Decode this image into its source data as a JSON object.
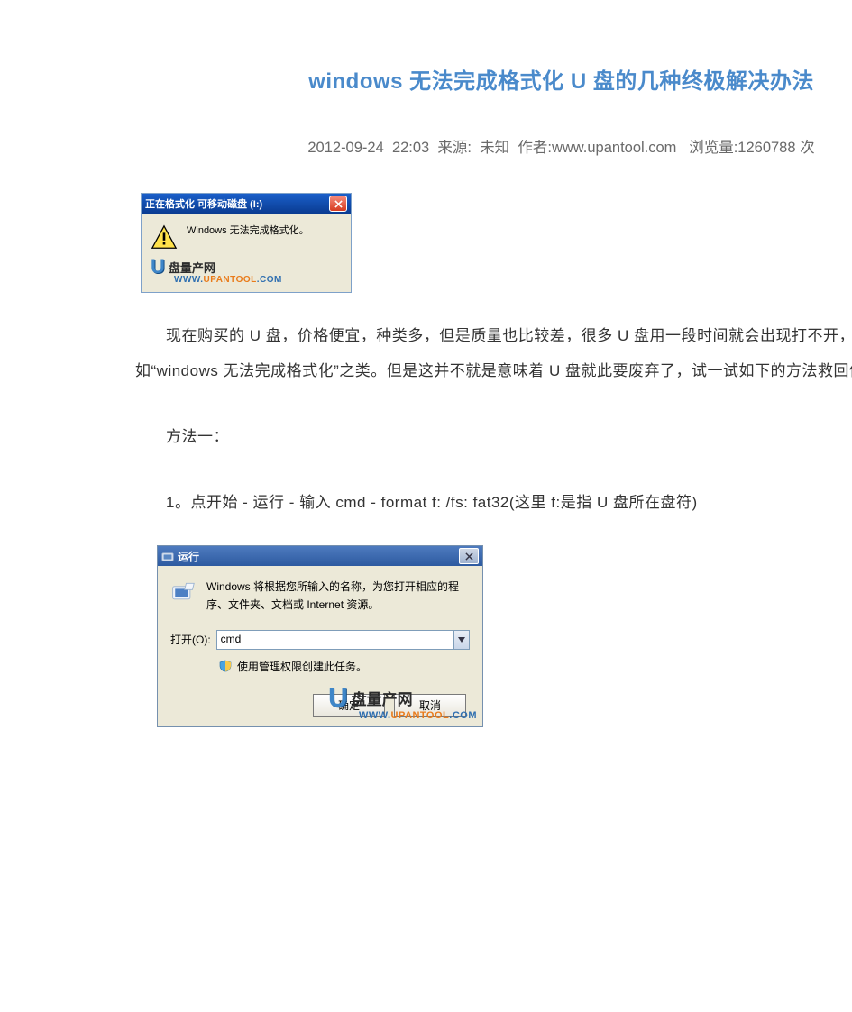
{
  "title": "windows 无法完成格式化 U 盘的几种终极解决办法",
  "meta": {
    "date": "2012-09-24",
    "time": "22:03",
    "source_label": "来源:",
    "source_value": "未知",
    "author_label": "作者:",
    "author_value": "www.upantool.com",
    "views_label": "浏览量:",
    "views_value": "1260788 次"
  },
  "dialog1": {
    "title": "正在格式化 可移动磁盘 (I:)",
    "message": "Windows 无法完成格式化。"
  },
  "watermark": {
    "letter": "U",
    "cn": "盘量产网",
    "www": "WWW.",
    "domain": "UPANTOOL",
    "tld": ".COM"
  },
  "paragraphs": {
    "intro": "现在购买的 U 盘，价格便宜，种类多，但是质量也比较差，很多 U 盘用一段时间就会出现打不开，格式化失败，提示如“windows 无法完成格式化”之类。但是这并不就是意味着 U 盘就此要废弃了，试一试如下的方法救回你的 U 盘：",
    "method1_label": "方法一：",
    "step1": "1。点开始 - 运行 - 输入 cmd - format  f:  /fs:  fat32(这里 f:是指 U 盘所在盘符)"
  },
  "dialog2": {
    "title": "运行",
    "description": "Windows 将根据您所输入的名称，为您打开相应的程序、文件夹、文档或 Internet 资源。",
    "open_label": "打开(O):",
    "open_value": "cmd",
    "admin_note": "使用管理权限创建此任务。",
    "ok_label": "确定",
    "cancel_label": "取消"
  }
}
